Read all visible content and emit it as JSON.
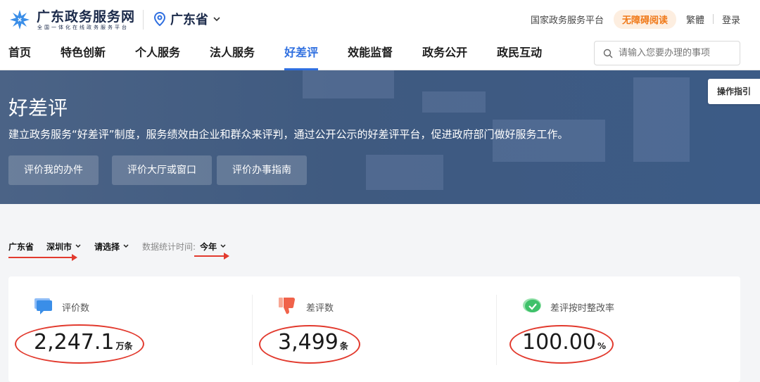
{
  "header": {
    "site_name": "广东政务服务网",
    "site_subtitle": "全国一体化在线政务服务平台",
    "location": "广东省",
    "links": [
      "国家政务服务平台",
      "无障碍阅读",
      "繁體",
      "登录"
    ]
  },
  "nav": {
    "items": [
      "首页",
      "特色创新",
      "个人服务",
      "法人服务",
      "好差评",
      "效能监督",
      "政务公开",
      "政民互动"
    ],
    "active_index": 4,
    "search_placeholder": "请输入您要办理的事项"
  },
  "banner": {
    "title": "好差评",
    "description": "建立政务服务“好差评”制度，服务绩效由企业和群众来评判，通过公开公示的好差评平台，促进政府部门做好服务工作。",
    "buttons": [
      "评价我的办件",
      "评价大厅或窗口",
      "评价办事指南"
    ],
    "guide_label": "操作指引"
  },
  "filters": {
    "province": "广东省",
    "city": "深圳市",
    "district": "请选择",
    "time_label": "数据统计时间:",
    "time_value": "今年"
  },
  "stats": [
    {
      "label": "评价数",
      "value": "2,247.1",
      "unit": "万条",
      "icon": "chat-bubble-icon"
    },
    {
      "label": "差评数",
      "value": "3,499",
      "unit": "条",
      "icon": "thumbs-down-icon"
    },
    {
      "label": "差评按时整改率",
      "value": "100.00",
      "unit": "%",
      "icon": "check-bubble-icon"
    }
  ],
  "colors": {
    "accent": "#2f6fe0",
    "annotation": "#e23a2e",
    "banner": "#3f5a80",
    "access": "#f07a1a"
  }
}
